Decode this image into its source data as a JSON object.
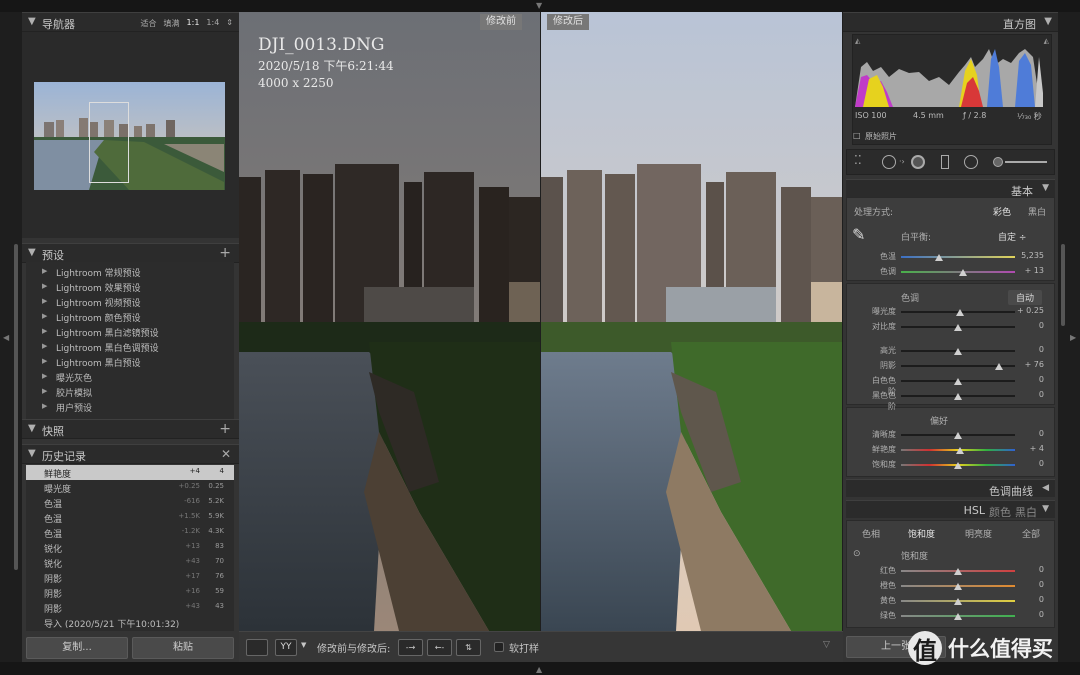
{
  "navigator": {
    "title": "导航器",
    "modes": [
      "适合",
      "填满",
      "1:1",
      "1:4"
    ]
  },
  "presets": {
    "title": "预设",
    "items": [
      "Lightroom 常规预设",
      "Lightroom 效果预设",
      "Lightroom 视频预设",
      "Lightroom 颜色预设",
      "Lightroom 黑白滤镜预设",
      "Lightroom 黑白色调预设",
      "Lightroom 黑白预设",
      "曝光灰色",
      "胶片模拟",
      "用户预设"
    ]
  },
  "snapshots": {
    "title": "快照"
  },
  "history": {
    "title": "历史记录",
    "rows": [
      {
        "name": "鲜艳度",
        "delta": "+4",
        "value": "4"
      },
      {
        "name": "曝光度",
        "delta": "+0.25",
        "value": "0.25"
      },
      {
        "name": "色温",
        "delta": "-616",
        "value": "5.2K"
      },
      {
        "name": "色温",
        "delta": "+1.5K",
        "value": "5.9K"
      },
      {
        "name": "色温",
        "delta": "-1.2K",
        "value": "4.3K"
      },
      {
        "name": "锐化",
        "delta": "+13",
        "value": "83"
      },
      {
        "name": "锐化",
        "delta": "+43",
        "value": "70"
      },
      {
        "name": "阴影",
        "delta": "+17",
        "value": "76"
      },
      {
        "name": "阴影",
        "delta": "+16",
        "value": "59"
      },
      {
        "name": "阴影",
        "delta": "+43",
        "value": "43"
      },
      {
        "name": "导入 (2020/5/21 下午10:01:32)",
        "delta": "",
        "value": ""
      }
    ]
  },
  "left_buttons": {
    "copy": "复制...",
    "paste": "粘贴"
  },
  "photo": {
    "before_tag": "修改前",
    "after_tag": "修改后",
    "filename": "DJI_0013.DNG",
    "datetime": "2020/5/18 下午6:21:44",
    "dimensions": "4000 x 2250"
  },
  "toolbar": {
    "compare_label": "修改前与修改后:",
    "softproof_label": "软打样",
    "view_mode": "YY"
  },
  "histogram": {
    "title": "直方图",
    "iso": "ISO 100",
    "focal": "4.5 mm",
    "aperture": "ƒ / 2.8",
    "shutter": "¹⁄₇₃₀ 秒",
    "original_photo": "原始照片"
  },
  "basic": {
    "title": "基本",
    "treatment_label": "处理方式:",
    "treatment_color": "彩色",
    "treatment_bw": "黑白",
    "wb_label": "白平衡:",
    "wb_value": "自定 ÷",
    "tone_label": "色调",
    "tone_auto": "自动",
    "presence_label": "偏好",
    "sliders": [
      {
        "label": "色温",
        "value": "5,235",
        "pos": 0.33
      },
      {
        "label": "色调",
        "value": "+ 13",
        "pos": 0.54
      },
      {
        "label": "曝光度",
        "value": "+ 0.25",
        "pos": 0.52
      },
      {
        "label": "对比度",
        "value": "0",
        "pos": 0.5
      },
      {
        "label": "高光",
        "value": "0",
        "pos": 0.5
      },
      {
        "label": "阴影",
        "value": "+ 76",
        "pos": 0.86
      },
      {
        "label": "白色色阶",
        "value": "0",
        "pos": 0.5
      },
      {
        "label": "黑色色阶",
        "value": "0",
        "pos": 0.5
      },
      {
        "label": "清晰度",
        "value": "0",
        "pos": 0.5
      },
      {
        "label": "鲜艳度",
        "value": "+ 4",
        "pos": 0.52
      },
      {
        "label": "饱和度",
        "value": "0",
        "pos": 0.5
      }
    ]
  },
  "tone_curve": {
    "title": "色调曲线"
  },
  "hsl": {
    "title": "HSL",
    "alt1": "颜色",
    "alt2": "黑白",
    "tabs": [
      "色相",
      "饱和度",
      "明亮度",
      "全部"
    ],
    "section_label": "饱和度",
    "sliders": [
      {
        "label": "红色",
        "value": "0"
      },
      {
        "label": "橙色",
        "value": "0"
      },
      {
        "label": "黄色",
        "value": "0"
      },
      {
        "label": "绿色",
        "value": "0"
      }
    ]
  },
  "right_buttons": {
    "previous": "上一张"
  },
  "watermark": {
    "badge": "值",
    "text": "什么值得买"
  }
}
